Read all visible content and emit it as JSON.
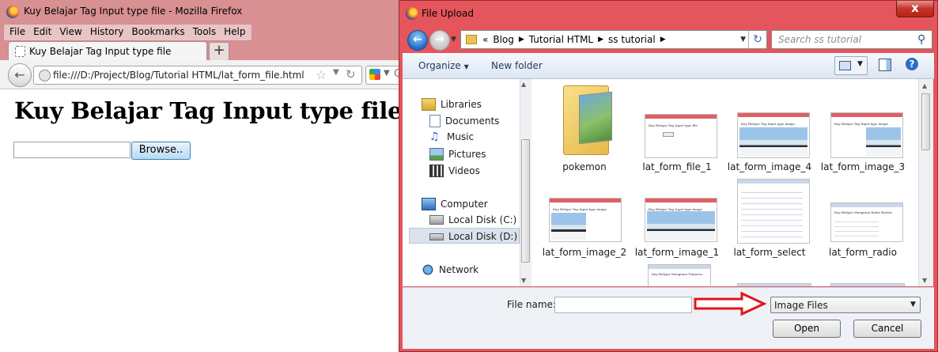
{
  "firefox": {
    "window_title": "Kuy Belajar Tag Input type file - Mozilla Firefox",
    "menu": [
      "File",
      "Edit",
      "View",
      "History",
      "Bookmarks",
      "Tools",
      "Help"
    ],
    "tab_title": "Kuy Belajar Tag Input type file",
    "new_tab_label": "+",
    "url": "file:///D:/Project/Blog/Tutorial HTML/lat_form_file.html",
    "search_engine_letter": "G",
    "page": {
      "heading": "Kuy Belajar Tag Input type file",
      "file_input_value": "",
      "browse_label": "Browse.."
    }
  },
  "dialog": {
    "title": "File Upload",
    "close_label": "x",
    "breadcrumb": [
      "«",
      "Blog",
      "Tutorial HTML",
      "ss tutorial"
    ],
    "search_placeholder": "Search ss tutorial",
    "toolbar": {
      "organize": "Organize",
      "new_folder": "New folder"
    },
    "nav": {
      "libraries": "Libraries",
      "documents": "Documents",
      "music": "Music",
      "pictures": "Pictures",
      "videos": "Videos",
      "computer": "Computer",
      "disk_c": "Local Disk (C:)",
      "disk_d": "Local Disk (D:)",
      "network": "Network"
    },
    "files": [
      {
        "name": "pokemon",
        "kind": "folder"
      },
      {
        "name": "lat_form_file_1",
        "kind": "browser",
        "thumb_title": "Kuy Belajar Tag Input type file"
      },
      {
        "name": "lat_form_image_4",
        "kind": "penguin",
        "thumb_title": "Kuy Belajar Tag Input type image"
      },
      {
        "name": "lat_form_image_3",
        "kind": "penguin",
        "thumb_title": "Kuy Belajar Tag Input type image"
      },
      {
        "name": "lat_form_image_2",
        "kind": "penguin",
        "thumb_title": "Kuy Belajar Tag Input type image"
      },
      {
        "name": "lat_form_image_1",
        "kind": "penguin",
        "thumb_title": "Kuy Belajar Tag Input type image"
      },
      {
        "name": "lat_form_select",
        "kind": "form",
        "thumb_title": ""
      },
      {
        "name": "lat_form_radio",
        "kind": "form",
        "thumb_title": "Kuy Belajar Mengenai Radio Button"
      },
      {
        "name": "",
        "kind": "form",
        "thumb_title": "Kuy Belajar Mengenai Textarea"
      }
    ],
    "file_name_label": "File name:",
    "file_name_value": "",
    "file_type": "Image Files",
    "open_label": "Open",
    "cancel_label": "Cancel"
  },
  "colors": {
    "firefox_frame": "#d89093",
    "dialog_frame": "#e4555c",
    "annotation_arrow": "#e3131b",
    "browse_button": "#b7daf3"
  }
}
